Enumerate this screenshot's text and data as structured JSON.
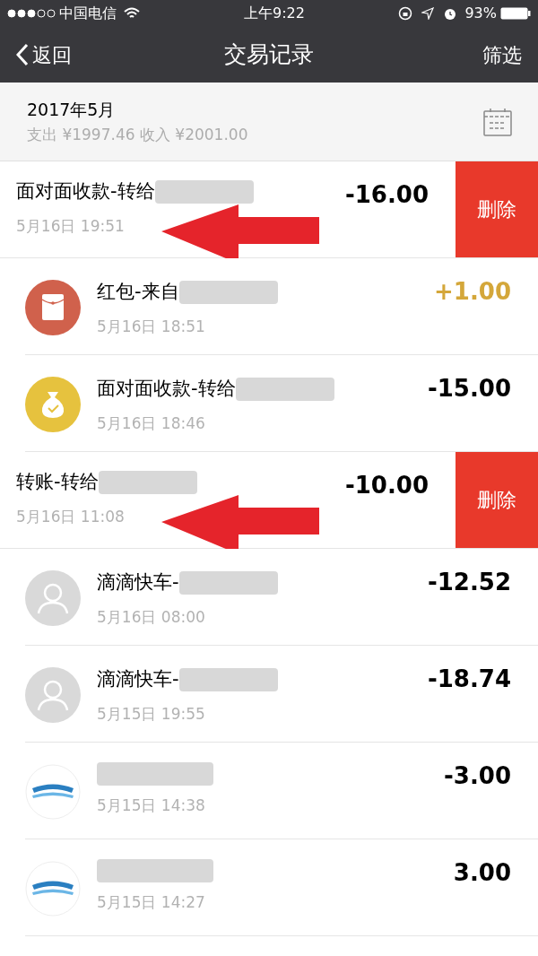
{
  "status_bar": {
    "carrier": "中国电信",
    "time": "上午9:22",
    "battery": "93%"
  },
  "nav": {
    "back": "返回",
    "title": "交易记录",
    "action": "筛选"
  },
  "summary": {
    "month": "2017年5月",
    "totals": "支出 ¥1997.46 收入 ¥2001.00"
  },
  "rows": [
    {
      "kind": "swiped",
      "title": "面对面收款-转给",
      "redacted": true,
      "date": "5月16日 19:51",
      "amount": "-16.00",
      "income": false,
      "delete": "删除",
      "annotation_arrow": true
    },
    {
      "kind": "redpacket",
      "title": "红包-来自",
      "redacted": true,
      "date": "5月16日 18:51",
      "amount": "+1.00",
      "income": true,
      "annotation_arrow": false
    },
    {
      "kind": "moneybag",
      "title": "面对面收款-转给",
      "redacted": true,
      "date": "5月16日 18:46",
      "amount": "-15.00",
      "income": false,
      "annotation_arrow": false
    },
    {
      "kind": "swiped",
      "title": "转账-转给",
      "redacted": true,
      "date": "5月16日 11:08",
      "amount": "-10.00",
      "income": false,
      "delete": "删除",
      "annotation_arrow": true
    },
    {
      "kind": "person",
      "title": "滴滴快车-",
      "redacted": true,
      "date": "5月16日 08:00",
      "amount": "-12.52",
      "income": false,
      "annotation_arrow": false
    },
    {
      "kind": "person",
      "title": "滴滴快车-",
      "redacted": true,
      "date": "5月15日 19:55",
      "amount": "-18.74",
      "income": false,
      "annotation_arrow": false
    },
    {
      "kind": "logo",
      "redacted": true,
      "date": "5月15日 14:38",
      "amount": "-3.00",
      "income": false,
      "annotation_arrow": false
    },
    {
      "kind": "logo",
      "redacted": true,
      "date": "5月15日 14:27",
      "amount": "3.00",
      "income": false,
      "annotation_arrow": false
    }
  ]
}
